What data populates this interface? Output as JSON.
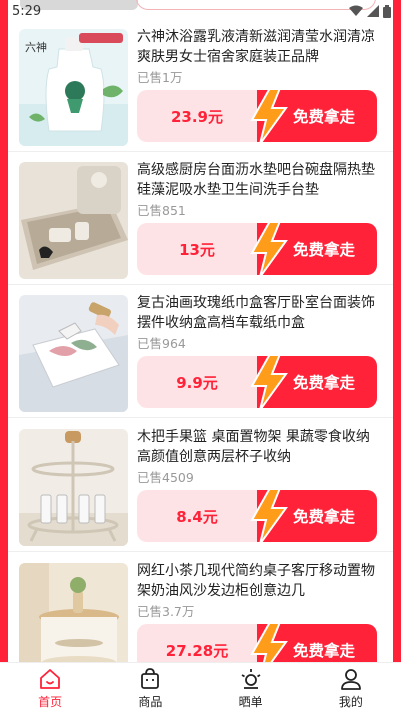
{
  "status_bar": {
    "time": "5:29"
  },
  "products": [
    {
      "title": "六神沐浴露乳液清新滋润清莹水润清凉爽肤男女士宿舍家庭装正品牌",
      "sold": "已售1万",
      "price": "23.9元",
      "cta": "免费拿走",
      "image_text": "六神"
    },
    {
      "title": "高级感厨房台面沥水垫吧台碗盘隔热垫硅藻泥吸水垫卫生间洗手台垫",
      "sold": "已售851",
      "price": "13元",
      "cta": "免费拿走"
    },
    {
      "title": "复古油画玫瑰纸巾盒客厅卧室台面装饰摆件收纳盒高档车载纸巾盒",
      "sold": "已售964",
      "price": "9.9元",
      "cta": "免费拿走"
    },
    {
      "title": "木把手果篮 桌面置物架 果蔬零食收纳 高颜值创意两层杯子收纳",
      "sold": "已售4509",
      "price": "8.4元",
      "cta": "免费拿走"
    },
    {
      "title": "网红小茶几现代简约桌子客厅移动置物架奶油风沙发边柜创意边几",
      "sold": "已售3.7万",
      "price": "27.28元",
      "cta": "免费拿走"
    }
  ],
  "tabbar": [
    {
      "label": "首页",
      "icon": "home-icon",
      "active": true
    },
    {
      "label": "商品",
      "icon": "bag-icon",
      "active": false
    },
    {
      "label": "晒单",
      "icon": "sun-icon",
      "active": false
    },
    {
      "label": "我的",
      "icon": "user-icon",
      "active": false
    }
  ],
  "colors": {
    "accent": "#ff2238",
    "price_bg": "#fde3e6",
    "bolt": "#ff9c1a"
  }
}
